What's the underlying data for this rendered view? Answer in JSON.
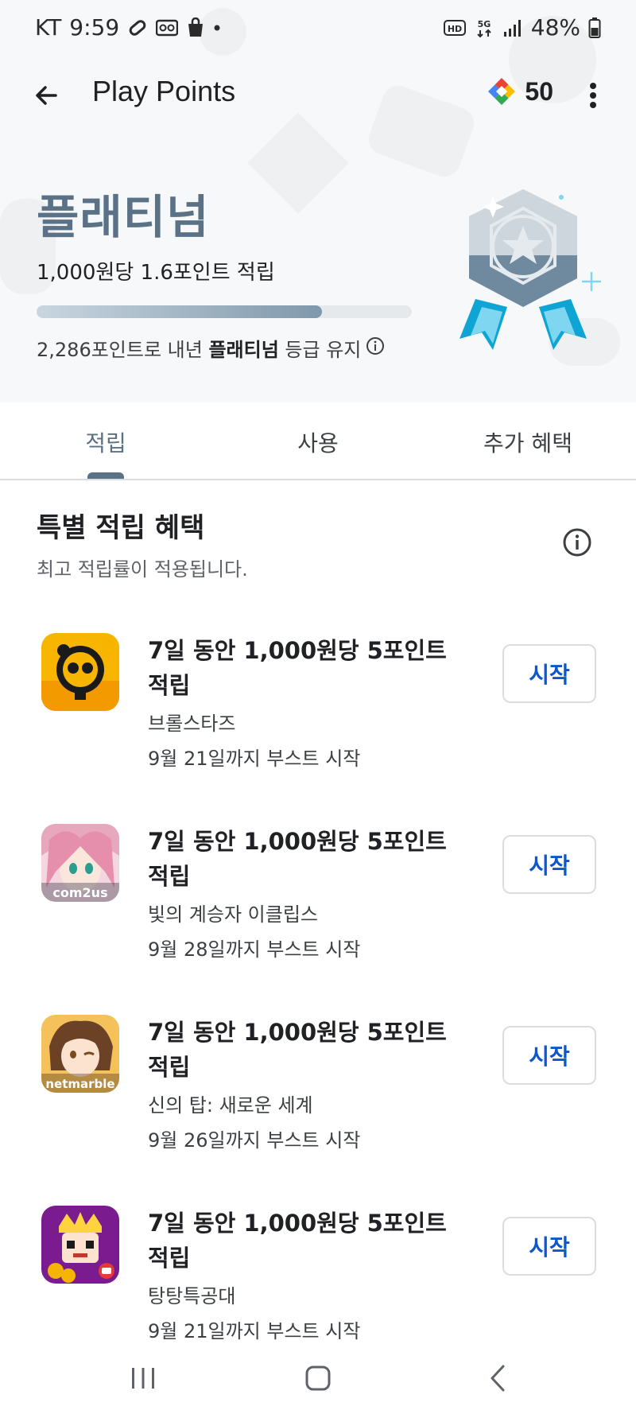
{
  "status_bar": {
    "carrier": "KT",
    "time": "9:59",
    "battery": "48%",
    "icons_left": [
      "link-icon",
      "voicemail-icon",
      "shopping-bag-icon",
      "dot-icon"
    ],
    "icons_right": [
      "hd-icon",
      "5g-icon",
      "signal-icon",
      "battery-icon"
    ]
  },
  "app_bar": {
    "title": "Play Points",
    "points": "50"
  },
  "tier": {
    "name": "플래티넘",
    "rate": "1,000원당 1.6포인트 적립",
    "progress_fraction": 0.76,
    "maintain_prefix": "2,286포인트로 내년 ",
    "maintain_tier": "플래티넘",
    "maintain_suffix": " 등급 유지"
  },
  "tabs": [
    {
      "label": "적립",
      "active": true
    },
    {
      "label": "사용",
      "active": false
    },
    {
      "label": "추가 혜택",
      "active": false
    }
  ],
  "section": {
    "title": "특별 적립 혜택",
    "subtitle": "최고 적립률이 적용됩니다."
  },
  "offers": [
    {
      "title": "7일 동안 1,000원당 5포인트 적립",
      "app": "브롤스타즈",
      "deadline": "9월 21일까지 부스트 시작",
      "button": "시작",
      "icon_label": ""
    },
    {
      "title": "7일 동안 1,000원당 5포인트 적립",
      "app": "빛의 계승자 이클립스",
      "deadline": "9월 28일까지 부스트 시작",
      "button": "시작",
      "icon_label": "com2us"
    },
    {
      "title": "7일 동안 1,000원당 5포인트 적립",
      "app": "신의 탑: 새로운 세계",
      "deadline": "9월 26일까지 부스트 시작",
      "button": "시작",
      "icon_label": "netmarble"
    },
    {
      "title": "7일 동안 1,000원당 5포인트 적립",
      "app": "탕탕특공대",
      "deadline": "9월 21일까지 부스트 시작",
      "button": "시작",
      "icon_label": ""
    }
  ],
  "colors": {
    "accent_tier": "#5b7286",
    "button_text": "#0b57d0"
  }
}
